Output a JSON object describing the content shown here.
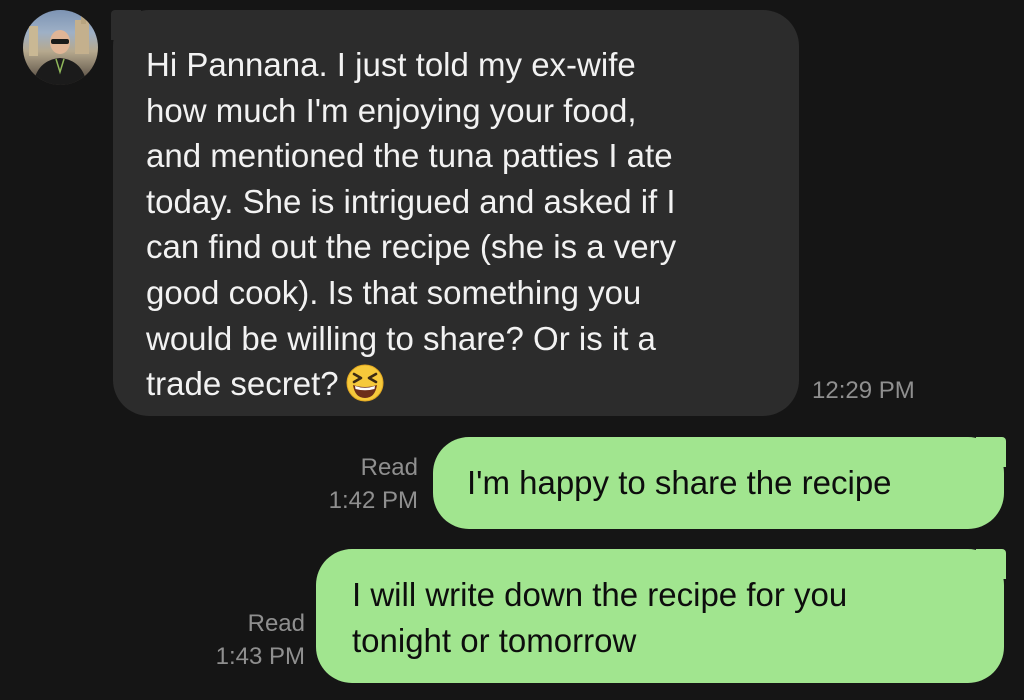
{
  "conversation": {
    "incoming": {
      "text": "Hi Pannana. I just told my ex-wife\nhow much I'm enjoying your food,\nand mentioned the tuna patties I ate\ntoday. She is intrigued and asked if I\ncan find out the recipe (she is a very\ngood cook). Is that something you\nwould be willing to share? Or is it a\ntrade secret?",
      "emoji": "laughing-squinting-face",
      "time": "12:29 PM"
    },
    "outgoing": [
      {
        "text": "I'm happy to share the recipe",
        "status": "Read",
        "time": "1:42 PM"
      },
      {
        "text": "I will write down the recipe for you\ntonight or tomorrow",
        "status": "Read",
        "time": "1:43 PM"
      }
    ]
  },
  "colors": {
    "background": "#151515",
    "incoming_bubble": "#2c2c2c",
    "outgoing_bubble": "#a1e58f",
    "meta_text": "#8f8f8f"
  }
}
